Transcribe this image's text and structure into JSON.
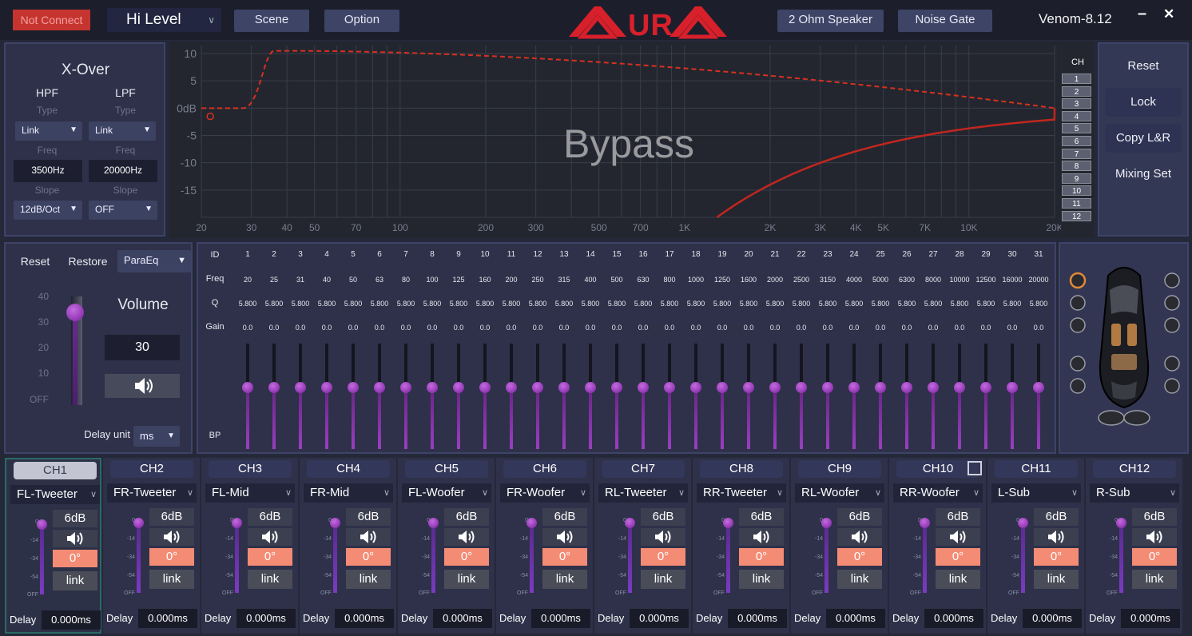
{
  "topbar": {
    "connection_status": "Not Connect",
    "input_level": "Hi Level",
    "scene_label": "Scene",
    "option_label": "Option",
    "speaker_label": "2 Ohm Speaker",
    "noise_gate_label": "Noise Gate",
    "device_name": "Venom-8.12",
    "minimize_glyph": "–",
    "close_glyph": "✕",
    "logo_text": "AURA"
  },
  "xover": {
    "title": "X-Over",
    "hpf_label": "HPF",
    "lpf_label": "LPF",
    "type_label": "Type",
    "freq_label": "Freq",
    "slope_label": "Slope",
    "hpf_type": "Link",
    "lpf_type": "Link",
    "hpf_freq": "3500Hz",
    "lpf_freq": "20000Hz",
    "hpf_slope": "12dB/Oct",
    "lpf_slope": "OFF"
  },
  "graph": {
    "overlay_text": "Bypass",
    "y_ticks": [
      "10",
      "5",
      "0dB",
      "-5",
      "-10",
      "-15"
    ],
    "x_ticks": [
      "20",
      "30",
      "40",
      "50",
      "70",
      "100",
      "200",
      "300",
      "500",
      "700",
      "1K",
      "2K",
      "3K",
      "4K",
      "5K",
      "7K",
      "10K",
      "20K"
    ],
    "channel_label": "CH",
    "channels": [
      "1",
      "2",
      "3",
      "4",
      "5",
      "6",
      "7",
      "8",
      "9",
      "10",
      "11",
      "12"
    ]
  },
  "right_panel": {
    "reset": "Reset",
    "lock": "Lock",
    "copy_lr": "Copy L&R",
    "mixing_set": "Mixing Set"
  },
  "volume_panel": {
    "reset": "Reset",
    "restore": "Restore",
    "eq_mode": "ParaEq",
    "volume_title": "Volume",
    "volume_value": "30",
    "volume_level": 0.85,
    "ticks": [
      "40",
      "30",
      "20",
      "10",
      "OFF"
    ],
    "delay_unit_label": "Delay unit",
    "delay_unit": "ms"
  },
  "eq": {
    "row_labels": {
      "id": "ID",
      "freq": "Freq",
      "q": "Q",
      "gain": "Gain",
      "bp": "BP"
    },
    "ids": [
      "1",
      "2",
      "3",
      "4",
      "5",
      "6",
      "7",
      "8",
      "9",
      "10",
      "11",
      "12",
      "13",
      "14",
      "15",
      "16",
      "17",
      "18",
      "19",
      "20",
      "21",
      "22",
      "23",
      "24",
      "25",
      "26",
      "27",
      "28",
      "29",
      "30",
      "31"
    ],
    "freqs": [
      "20",
      "25",
      "31",
      "40",
      "50",
      "63",
      "80",
      "100",
      "125",
      "160",
      "200",
      "250",
      "315",
      "400",
      "500",
      "630",
      "800",
      "1000",
      "1250",
      "1600",
      "2000",
      "2500",
      "3150",
      "4000",
      "5000",
      "6300",
      "8000",
      "10000",
      "12500",
      "16000",
      "20000"
    ],
    "q": "5.800",
    "gain": "0.0"
  },
  "channels": [
    {
      "head": "CH1",
      "name": "FL-Tweeter",
      "db": "6dB",
      "phase": "0°",
      "link": "link",
      "delay_label": "Delay",
      "delay": "0.000ms"
    },
    {
      "head": "CH2",
      "name": "FR-Tweeter",
      "db": "6dB",
      "phase": "0°",
      "link": "link",
      "delay_label": "Delay",
      "delay": "0.000ms"
    },
    {
      "head": "CH3",
      "name": "FL-Mid",
      "db": "6dB",
      "phase": "0°",
      "link": "link",
      "delay_label": "Delay",
      "delay": "0.000ms"
    },
    {
      "head": "CH4",
      "name": "FR-Mid",
      "db": "6dB",
      "phase": "0°",
      "link": "link",
      "delay_label": "Delay",
      "delay": "0.000ms"
    },
    {
      "head": "CH5",
      "name": "FL-Woofer",
      "db": "6dB",
      "phase": "0°",
      "link": "link",
      "delay_label": "Delay",
      "delay": "0.000ms"
    },
    {
      "head": "CH6",
      "name": "FR-Woofer",
      "db": "6dB",
      "phase": "0°",
      "link": "link",
      "delay_label": "Delay",
      "delay": "0.000ms"
    },
    {
      "head": "CH7",
      "name": "RL-Tweeter",
      "db": "6dB",
      "phase": "0°",
      "link": "link",
      "delay_label": "Delay",
      "delay": "0.000ms"
    },
    {
      "head": "CH8",
      "name": "RR-Tweeter",
      "db": "6dB",
      "phase": "0°",
      "link": "link",
      "delay_label": "Delay",
      "delay": "0.000ms"
    },
    {
      "head": "CH9",
      "name": "RL-Woofer",
      "db": "6dB",
      "phase": "0°",
      "link": "link",
      "delay_label": "Delay",
      "delay": "0.000ms"
    },
    {
      "head": "CH10",
      "name": "RR-Woofer",
      "db": "6dB",
      "phase": "0°",
      "link": "link",
      "delay_label": "Delay",
      "delay": "0.000ms"
    },
    {
      "head": "CH11",
      "name": "L-Sub",
      "db": "6dB",
      "phase": "0°",
      "link": "link",
      "delay_label": "Delay",
      "delay": "0.000ms"
    },
    {
      "head": "CH12",
      "name": "R-Sub",
      "db": "6dB",
      "phase": "0°",
      "link": "link",
      "delay_label": "Delay",
      "delay": "0.000ms"
    }
  ],
  "channel_ticks": [
    "0",
    "-14",
    "-34",
    "-54",
    "OFF"
  ],
  "colors": {
    "accent": "#c6342f",
    "phase": "#f48b75",
    "knob": "#9a3ec0",
    "curve": "#d8301f"
  }
}
